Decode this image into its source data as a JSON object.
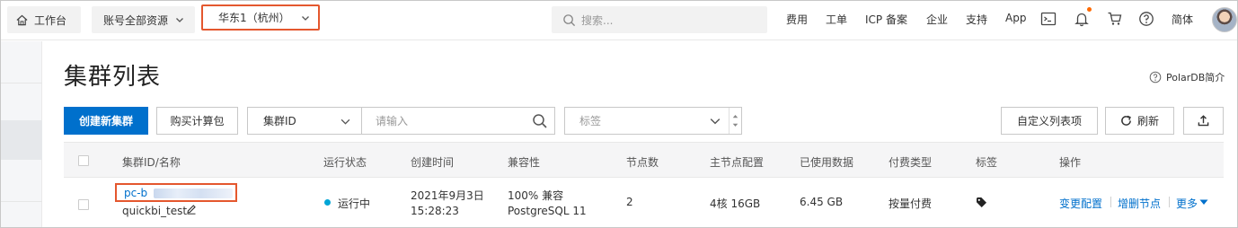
{
  "topbar": {
    "workbench_label": "工作台",
    "resources_label": "账号全部资源",
    "region_label": "华东1（杭州）",
    "search_placeholder": "搜索...",
    "nav_links": [
      "费用",
      "工单",
      "ICP 备案",
      "企业",
      "支持",
      "App"
    ],
    "language_label": "简体",
    "icons": [
      "terminal-icon",
      "bell-icon",
      "cart-icon",
      "help-icon"
    ]
  },
  "page": {
    "title": "集群列表",
    "intro_link": "PolarDB简介"
  },
  "toolbar": {
    "create_label": "创建新集群",
    "buy_label": "购买计算包",
    "filter_field": "集群ID",
    "filter_placeholder": "请输入",
    "tag_placeholder": "标签",
    "custom_columns_label": "自定义列表项",
    "refresh_label": "刷新"
  },
  "table": {
    "headers": [
      "集群ID/名称",
      "运行状态",
      "创建时间",
      "兼容性",
      "节点数",
      "主节点配置",
      "已使用数据",
      "付费类型",
      "标签",
      "操作"
    ],
    "rows": [
      {
        "cluster_id": "pc-b",
        "cluster_name": "quickbi_test",
        "status": "运行中",
        "created_date": "2021年9月3日",
        "created_time": "15:28:23",
        "compat_1": "100% 兼容",
        "compat_2": "PostgreSQL 11",
        "nodes": "2",
        "primary_spec": "4核 16GB",
        "used_data": "6.45 GB",
        "billing": "按量付费",
        "actions": [
          "变更配置",
          "增删节点",
          "更多"
        ]
      }
    ]
  },
  "colors": {
    "primary": "#0070cc",
    "highlight": "#e4572e",
    "status_running": "#00a5d6",
    "notification": "#ff6a00"
  }
}
